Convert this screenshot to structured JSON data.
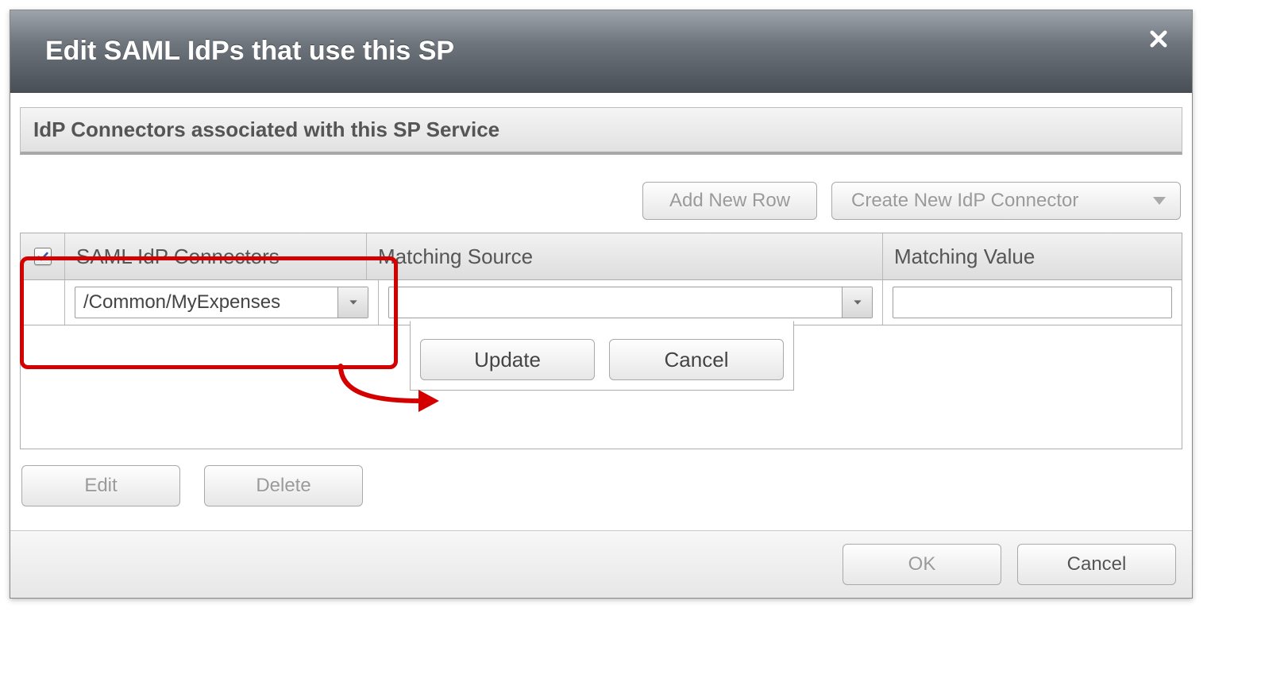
{
  "dialog": {
    "title": "Edit SAML IdPs that use this SP",
    "close_tooltip": "Close"
  },
  "section": {
    "heading": "IdP Connectors associated with this SP Service"
  },
  "toolbar": {
    "add_row_label": "Add New Row",
    "create_connector_label": "Create New IdP Connector"
  },
  "grid": {
    "columns": {
      "check": "",
      "connectors": "SAML IdP Connectors",
      "matching_source": "Matching Source",
      "matching_value": "Matching Value"
    },
    "row": {
      "checked": true,
      "connector_value": "/Common/MyExpenses",
      "matching_source_value": "",
      "matching_value": ""
    }
  },
  "inline_actions": {
    "update_label": "Update",
    "cancel_label": "Cancel"
  },
  "bottom_actions": {
    "edit_label": "Edit",
    "delete_label": "Delete"
  },
  "footer": {
    "ok_label": "OK",
    "cancel_label": "Cancel"
  }
}
